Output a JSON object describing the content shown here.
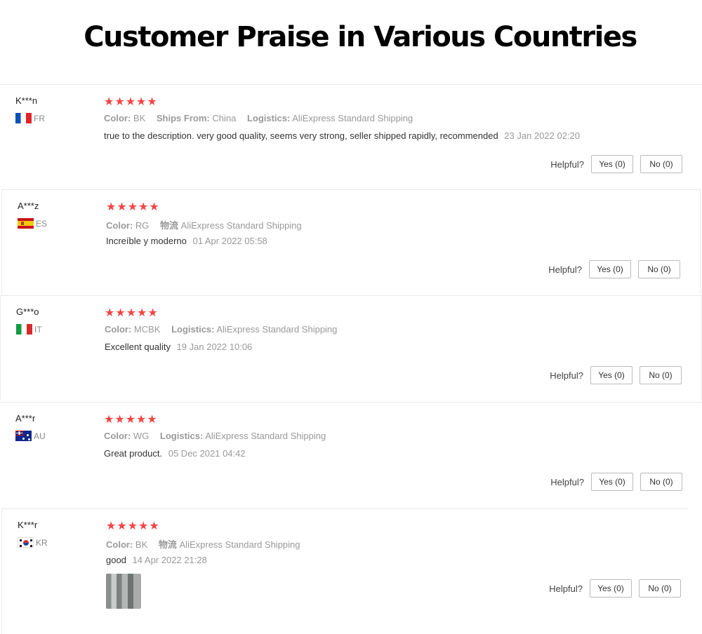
{
  "page": {
    "title": "Customer Praise in Various Countries"
  },
  "labels": {
    "helpful": "Helpful?"
  },
  "reviews": [
    {
      "user": "K***n",
      "country_code": "FR",
      "flag_icon": "france-flag-icon",
      "stars": "★★★★★",
      "rating": 5,
      "meta": [
        {
          "label": "Color:",
          "value": "BK"
        },
        {
          "label": "Ships From:",
          "value": "China"
        },
        {
          "label": "Logistics:",
          "value": "AliExpress Standard Shipping"
        }
      ],
      "text": "true to the description. very good quality, seems very strong, seller shipped rapidly, recommended",
      "date": "23 Jan 2022 02:20",
      "yes": "Yes (0)",
      "no": "No (0)"
    },
    {
      "user": "A***z",
      "country_code": "ES",
      "flag_icon": "spain-flag-icon",
      "stars": "★★★★★",
      "rating": 5,
      "meta": [
        {
          "label": "Color:",
          "value": "RG"
        },
        {
          "label": "物流",
          "value": "AliExpress Standard Shipping"
        }
      ],
      "text": "Increíble y moderno",
      "date": "01 Apr 2022 05:58",
      "yes": "Yes (0)",
      "no": "No (0)"
    },
    {
      "user": "G***o",
      "country_code": "IT",
      "flag_icon": "italy-flag-icon",
      "stars": "★★★★★",
      "rating": 5,
      "meta": [
        {
          "label": "Color:",
          "value": "MCBK"
        },
        {
          "label": "Logistics:",
          "value": "AliExpress Standard Shipping"
        }
      ],
      "text": "Excellent quality",
      "date": "19 Jan 2022 10:06",
      "yes": "Yes (0)",
      "no": "No (0)"
    },
    {
      "user": "A***r",
      "country_code": "AU",
      "flag_icon": "australia-flag-icon",
      "stars": "★★★★★",
      "rating": 5,
      "meta": [
        {
          "label": "Color:",
          "value": "WG"
        },
        {
          "label": "Logistics:",
          "value": "AliExpress Standard Shipping"
        }
      ],
      "text": "Great product.",
      "date": "05 Dec 2021 04:42",
      "yes": "Yes (0)",
      "no": "No (0)"
    },
    {
      "user": "K***r",
      "country_code": "KR",
      "flag_icon": "south-korea-flag-icon",
      "stars": "★★★★★",
      "rating": 5,
      "meta": [
        {
          "label": "Color:",
          "value": "BK"
        },
        {
          "label": "物流",
          "value": "AliExpress Standard Shipping"
        }
      ],
      "text": "good",
      "date": "14 Apr 2022 21:28",
      "yes": "Yes (0)",
      "no": "No (0)",
      "has_photo": true
    }
  ]
}
